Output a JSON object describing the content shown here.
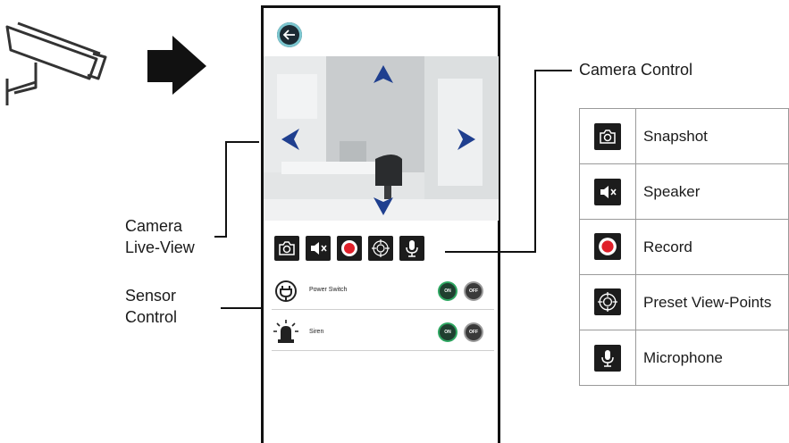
{
  "callouts": {
    "camera_control": "Camera Control",
    "live_view_line1": "Camera",
    "live_view_line2": "Live-View",
    "sensor_line1": "Sensor",
    "sensor_line2": "Control"
  },
  "toolbar": {
    "buttons": [
      "camera-icon",
      "speaker-muted-icon",
      "record-icon",
      "crosshair-icon",
      "microphone-icon"
    ]
  },
  "sensors": [
    {
      "label": "Power Switch",
      "icon": "power-plug-icon",
      "on_label": "ON",
      "off_label": "OFF"
    },
    {
      "label": "Siren",
      "icon": "siren-icon",
      "on_label": "ON",
      "off_label": "OFF"
    }
  ],
  "legend": [
    {
      "icon": "camera-icon",
      "label": "Snapshot"
    },
    {
      "icon": "speaker-muted-icon",
      "label": "Speaker"
    },
    {
      "icon": "record-icon",
      "label": "Record"
    },
    {
      "icon": "crosshair-icon",
      "label": "Preset View-Points"
    },
    {
      "icon": "microphone-icon",
      "label": "Microphone"
    }
  ],
  "colors": {
    "ptz_arrow": "#1f3f8f",
    "record_red": "#e0202a",
    "toggle_on_ring": "#2ea661",
    "back_ring": "#7cc6cf"
  }
}
